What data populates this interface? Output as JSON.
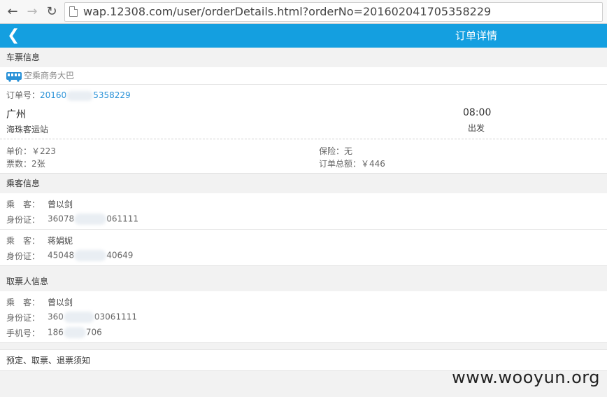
{
  "browser": {
    "url": "wap.12308.com/user/orderDetails.html?orderNo=201602041705358229"
  },
  "header": {
    "title": "订单详情"
  },
  "ticket": {
    "section_title": "车票信息",
    "bus_type": "空乘商务大巴",
    "order_label": "订单号：",
    "order_no_prefix": "20160",
    "order_no_suffix": "5358229",
    "city": "广州",
    "station": "海珠客运站",
    "time": "08:00",
    "depart_label": "出发",
    "price_label": "单价：",
    "price": "￥223",
    "count_label": "票数：",
    "count": "2张",
    "insurance_label": "保险：",
    "insurance": "无",
    "total_label": "订单总额：",
    "total": "￥446"
  },
  "passengers": {
    "section_title": "乘客信息",
    "name_label": "乘　客：",
    "id_label": "身份证：",
    "items": [
      {
        "name": "曾以剑",
        "id_prefix": "36078",
        "id_suffix": "061111"
      },
      {
        "name": "蒋娟妮",
        "id_prefix": "45048",
        "id_suffix": "40649"
      }
    ]
  },
  "pickup": {
    "section_title": "取票人信息",
    "name_label": "乘　客：",
    "id_label": "身份证：",
    "phone_label": "手机号：",
    "name": "曾以剑",
    "id_prefix": "360",
    "id_suffix": "03061111",
    "phone_prefix": "186",
    "phone_suffix": "706"
  },
  "notice": {
    "label": "预定、取票、退票须知"
  },
  "watermark": "www.wooyun.org"
}
